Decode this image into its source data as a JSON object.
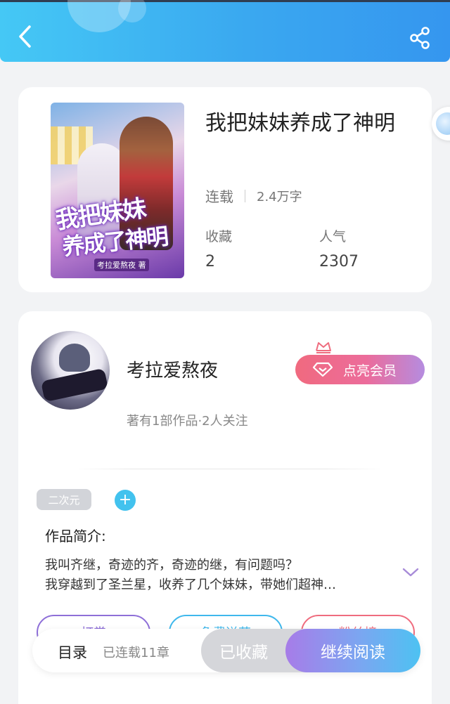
{
  "header": {
    "back_icon": "chevron-left-icon",
    "share_icon": "share-icon"
  },
  "book": {
    "title": "我把妹妹养成了神明",
    "status": "连载",
    "word_count": "2.4万字",
    "stats": [
      {
        "label": "收藏",
        "value": "2"
      },
      {
        "label": "人气",
        "value": "2307"
      }
    ],
    "cover": {
      "title_line1": "我把妹妹",
      "title_line2": "养成了神明",
      "author_tag": "考拉爱熬夜 著"
    }
  },
  "author": {
    "name": "考拉爱熬夜",
    "meta": "著有1部作品·2人关注",
    "vip_button": "点亮会员"
  },
  "tags": {
    "items": [
      "二次元"
    ],
    "add_label": "+"
  },
  "intro": {
    "label": "作品简介:",
    "lines": [
      "我叫齐继，奇迹的齐，奇迹的继，有问题吗？",
      "我穿越到了圣兰星，收养了几个妹妹，带她们超神…"
    ]
  },
  "actions": [
    {
      "label": "打赏",
      "color": "#8e6fd8"
    },
    {
      "label": "免费送花",
      "color": "#3fb8ec"
    },
    {
      "label": "粉丝榜",
      "color": "#ef6c7e"
    }
  ],
  "bottom_bar": {
    "toc_label": "目录",
    "chapter_count": "已连载11章",
    "collected_label": "已收藏",
    "continue_label": "继续阅读"
  },
  "colors": {
    "header_gradient": [
      "#45c8f5",
      "#3596ef"
    ],
    "accent_blue": "#42c2ee",
    "vip_pink": "#f06a7f"
  }
}
